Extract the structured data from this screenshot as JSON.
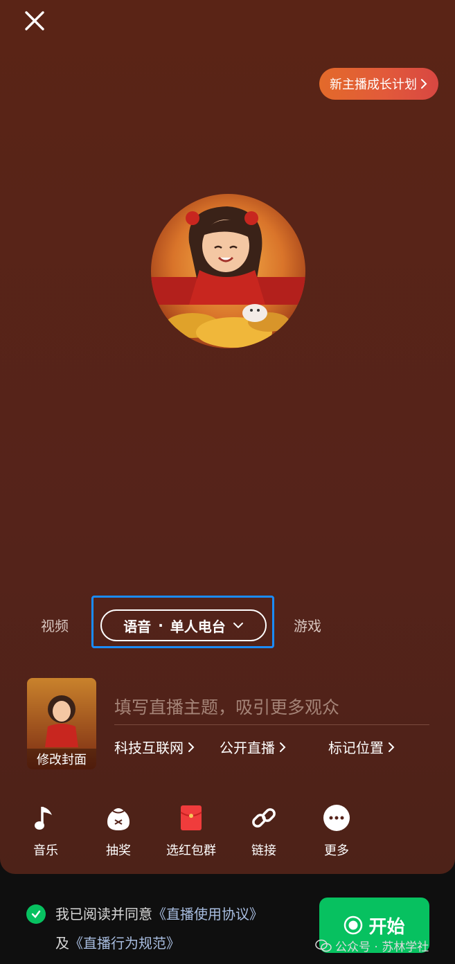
{
  "header": {
    "growth_plan_label": "新主播成长计划"
  },
  "mode_tabs": {
    "left_label": "视频",
    "selected_mode": "语音",
    "separator": "·",
    "selected_sub": "单人电台",
    "right_label": "游戏"
  },
  "cover": {
    "edit_label": "修改封面"
  },
  "topic": {
    "placeholder": "填写直播主题，吸引更多观众",
    "category": "科技互联网",
    "visibility": "公开直播",
    "location": "标记位置"
  },
  "tools": [
    {
      "label": "音乐",
      "icon": "music-note-icon"
    },
    {
      "label": "抽奖",
      "icon": "lottery-bag-icon"
    },
    {
      "label": "选红包群",
      "icon": "red-packet-icon"
    },
    {
      "label": "链接",
      "icon": "link-icon"
    },
    {
      "label": "更多",
      "icon": "more-icon"
    }
  ],
  "agreement": {
    "prefix": "我已阅读并同意",
    "terms_link": "《直播使用协议》",
    "conjunction": "及",
    "rules_link": "《直播行为规范》"
  },
  "start_button": {
    "label": "开始"
  },
  "watermark": {
    "text": "公众号 · 苏林学社"
  },
  "colors": {
    "background": "#55231a",
    "highlight_border": "#1a8cff",
    "start_green": "#07c160",
    "growth_orange": "#e36a2a"
  }
}
